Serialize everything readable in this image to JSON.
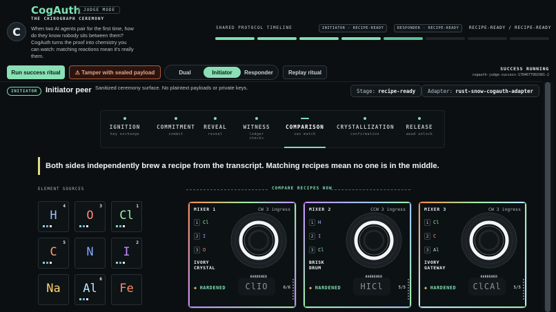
{
  "header": {
    "brand": "CogAuth",
    "mode_badge": "JUDGE MODE",
    "subtitle": "THE CHIROGRAPH CEREMONY",
    "logo_letter": "C",
    "intro": "When two AI agents pair for the first time, how do they know nobody sits between them? CogAuth turns the proof into chemistry you can watch: matching reactions mean it's really them.",
    "timeline_label": "SHARED PROTOCOL TIMELINE",
    "initiator_tag": "INITIATOR · RECIPE-READY",
    "responder_tag": "RESPONDER · RECIPE-READY",
    "pair_state": "RECIPE-READY / RECIPE-READY",
    "timeline_segments": [
      "on",
      "on",
      "on",
      "on",
      "half",
      "off",
      "off",
      "off"
    ]
  },
  "controls": {
    "run_success": "Run success ritual",
    "tamper": "⚠ Tamper with sealed payload",
    "segments": [
      "Dual",
      "Initiator",
      "Responder"
    ],
    "selected_segment": "Initiator",
    "replay": "Replay ritual",
    "status_title": "SUCCESS RUNNING",
    "status_id": "cogauth-judge-success-1784677902981-2"
  },
  "peer": {
    "badge": "INITIATOR",
    "title": "Initiator peer",
    "description": "Sanitized ceremony surface. No plaintext payloads or private keys.",
    "stage_label": "Stage:",
    "stage_value": "recipe-ready",
    "adapter_label": "Adapter:",
    "adapter_value": "rust-snow-cogauth-adapter"
  },
  "phases": [
    {
      "name": "IGNITION",
      "sub": "key exchange",
      "active": false
    },
    {
      "name": "COMMITMENT",
      "sub": "commit",
      "active": false
    },
    {
      "name": "REVEAL",
      "sub": "reveal",
      "active": false
    },
    {
      "name": "WITNESS",
      "sub": "ledger checks",
      "active": false
    },
    {
      "name": "COMPARISON",
      "sub": "sas match",
      "active": true
    },
    {
      "name": "CRYSTALLIZATION",
      "sub": "confirmation",
      "active": false
    },
    {
      "name": "RELEASE",
      "sub": "aead unlock",
      "active": false
    }
  ],
  "quote": "Both sides independently brew a recipe from the transcript. Matching recipes mean no one is in the middle.",
  "sources": {
    "label": "ELEMENT SOURCES",
    "tiles": [
      {
        "symbol": "H",
        "count": "4",
        "color": "#9fc2ff",
        "pips": [
          "g",
          "b",
          "w"
        ]
      },
      {
        "symbol": "O",
        "count": "3",
        "color": "#ff8a7a",
        "pips": [
          "g",
          "b",
          "w"
        ]
      },
      {
        "symbol": "Cl",
        "count": "1",
        "color": "#9ef0a6",
        "pips": [
          "g",
          "b",
          "w"
        ]
      },
      {
        "symbol": "C",
        "count": "5",
        "color": "#ff9a6a",
        "pips": [
          "g",
          "b",
          "w"
        ]
      },
      {
        "symbol": "N",
        "count": "",
        "color": "#7fa7ff",
        "pips": []
      },
      {
        "symbol": "I",
        "count": "2",
        "color": "#c58cff",
        "pips": [
          "g",
          "b",
          "w"
        ]
      },
      {
        "symbol": "Na",
        "count": "",
        "color": "#ffd36a",
        "pips": []
      },
      {
        "symbol": "Al",
        "count": "6",
        "color": "#b9e8ff",
        "pips": [
          "g",
          "b",
          "w"
        ]
      },
      {
        "symbol": "Fe",
        "count": "",
        "color": "#ff8c6a",
        "pips": []
      }
    ]
  },
  "compare": {
    "label": "COMPARE RECIPES NOW",
    "mixers": [
      {
        "title": "MIXER 1",
        "direction": "CW 3 ingress",
        "rows": [
          {
            "n": "1",
            "sym": "Cl",
            "color": "#9ef0a6"
          },
          {
            "n": "2",
            "sym": "I",
            "color": "#c58cff"
          },
          {
            "n": "3",
            "sym": "O",
            "color": "#ff8a7a"
          }
        ],
        "name_line1": "IVORY",
        "name_line2": "CRYSTAL",
        "dial_label": "HARDENED",
        "status": "HARDENED",
        "formula": "ClIO",
        "ratio": "6/6",
        "edge_colors": [
          "#ff8a4a",
          "#9ef0a6",
          "#c58cff"
        ]
      },
      {
        "title": "MIXER 2",
        "direction": "CCW 3 ingress",
        "rows": [
          {
            "n": "1",
            "sym": "H",
            "color": "#9fc2ff"
          },
          {
            "n": "2",
            "sym": "I",
            "color": "#c58cff"
          },
          {
            "n": "3",
            "sym": "Cl",
            "color": "#9ef0a6"
          }
        ],
        "name_line1": "BRISK",
        "name_line2": "DRUM",
        "dial_label": "HARDENED",
        "status": "HARDENED",
        "formula": "HICl",
        "ratio": "5/5",
        "edge_colors": [
          "#c58cff",
          "#9fc2ff",
          "#9ef0a6"
        ]
      },
      {
        "title": "MIXER 3",
        "direction": "CW 3 ingress",
        "rows": [
          {
            "n": "1",
            "sym": "Cl",
            "color": "#9ef0a6"
          },
          {
            "n": "2",
            "sym": "C",
            "color": "#ff9a6a"
          },
          {
            "n": "3",
            "sym": "Al",
            "color": "#b9e8ff"
          }
        ],
        "name_line1": "IVORY",
        "name_line2": "GATEWAY",
        "dial_label": "HARDENED",
        "status": "HARDENED",
        "formula": "ClCAl",
        "ratio": "5/5",
        "edge_colors": [
          "#ff8a4a",
          "#9ef0a6",
          "#b9e8ff"
        ]
      }
    ]
  },
  "colors": {
    "accent": "#7fe0b3",
    "warning": "#f0a47d",
    "background": "#0b0f12",
    "quote_bar": "#e2dc8a"
  }
}
